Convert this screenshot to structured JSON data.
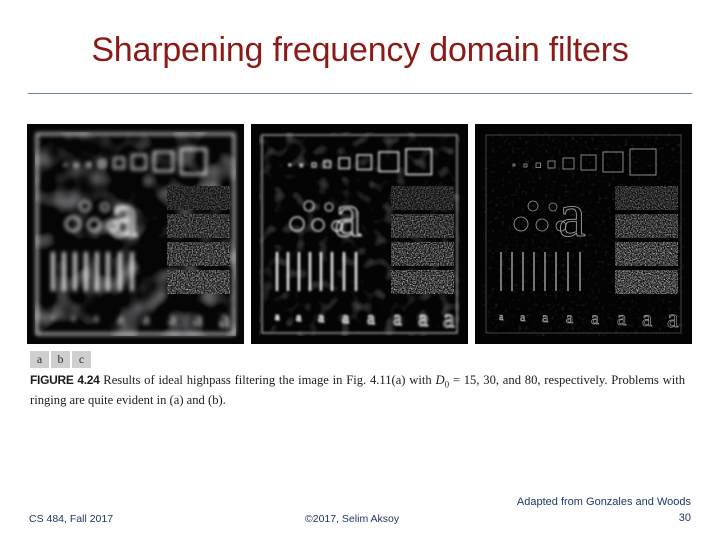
{
  "slide": {
    "title": "Sharpening frequency domain filters",
    "accent_color": "#8C1A16",
    "rule_color": "#5B8AA6",
    "footer_color": "#1F3864",
    "background": "#ffffff"
  },
  "figure": {
    "sublabels": [
      "a",
      "b",
      "c"
    ],
    "caption": {
      "figure_label": "FIGURE",
      "figure_number": "4.24",
      "line_1": "Results of ideal highpass filtering the image in Fig. 4.11(a) with ",
      "math_variable": "D",
      "math_subscript": "0",
      "line_2": " = 15, 30, and 80, respectively. Problems with ringing are quite evident in (a) and (b).",
      "full_text": "FIGURE 4.24 Results of ideal highpass filtering the image in Fig. 4.11(a) with D0 = 15, 30, and 80, respectively. Problems with ringing are quite evident in (a) and (b)."
    },
    "panels": [
      {
        "id": "panel-a",
        "sublabel": "a",
        "cutoff_D0": 15,
        "filter": "ideal highpass",
        "description": "Result of ideal highpass filtering with D0 = 15; strong ringing artifacts, thick blurred edges"
      },
      {
        "id": "panel-b",
        "sublabel": "b",
        "cutoff_D0": 30,
        "filter": "ideal highpass",
        "description": "Result of ideal highpass filtering with D0 = 30; moderate ringing, sharper edge outlines"
      },
      {
        "id": "panel-c",
        "sublabel": "c",
        "cutoff_D0": 80,
        "filter": "ideal highpass",
        "description": "Result of ideal highpass filtering with D0 = 80; minimal ringing, thin clean edges"
      }
    ]
  },
  "footer": {
    "attribution": "Adapted from Gonzales and Woods",
    "page_number": "30",
    "course": "CS 484, Fall 2017",
    "copyright": "©2017, Selim Aksoy"
  }
}
